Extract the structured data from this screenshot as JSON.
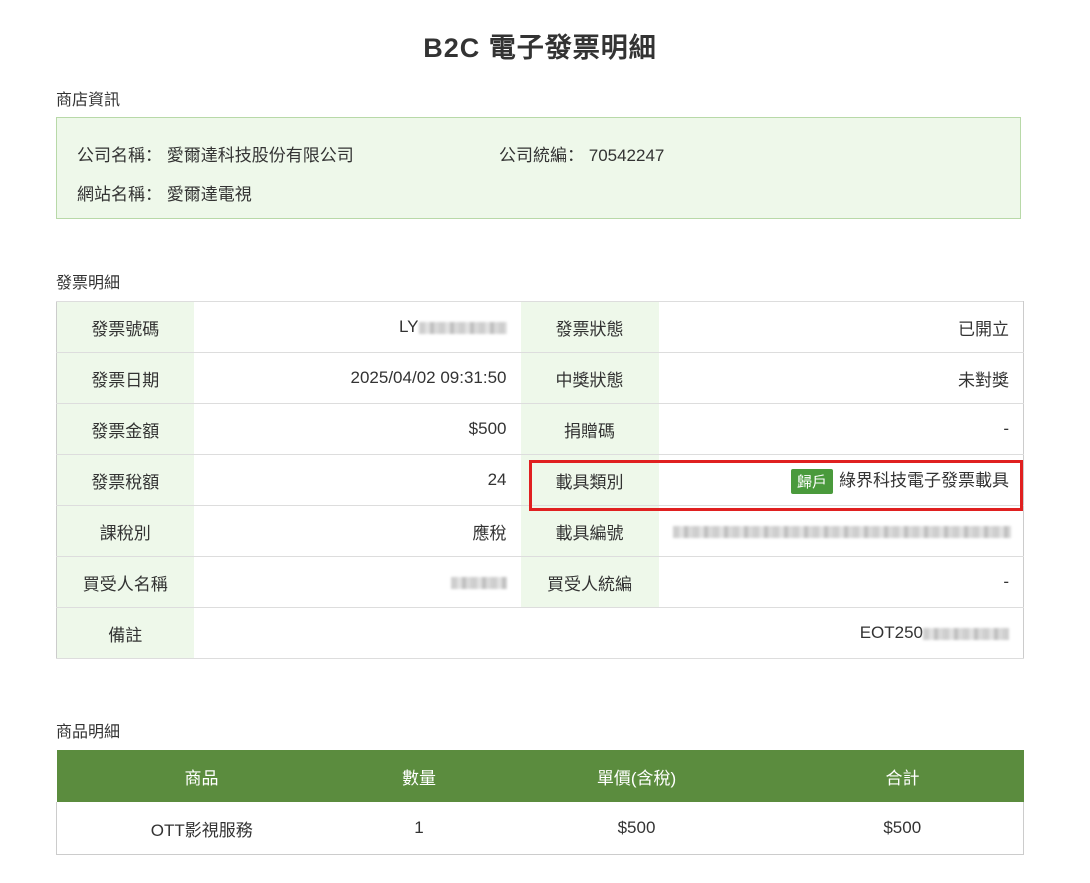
{
  "title": "B2C 電子發票明細",
  "store": {
    "section_label": "商店資訊",
    "company_name_label": "公司名稱：",
    "company_name": "愛爾達科技股份有限公司",
    "tax_id_label": "公司統編：",
    "tax_id": "70542247",
    "site_name_label": "網站名稱：",
    "site_name": "愛爾達電視"
  },
  "invoice": {
    "section_label": "發票明細",
    "number_label": "發票號碼",
    "number_prefix": "LY",
    "status_label": "發票狀態",
    "status": "已開立",
    "date_label": "發票日期",
    "date": "2025/04/02 09:31:50",
    "prize_label": "中獎狀態",
    "prize": "未對獎",
    "amount_label": "發票金額",
    "amount": "$500",
    "donation_label": "捐贈碼",
    "donation": "-",
    "tax_label": "發票稅額",
    "tax": "24",
    "carrier_type_label": "載具類別",
    "carrier_badge": "歸戶",
    "carrier_type": "綠界科技電子發票載具",
    "tax_type_label": "課稅別",
    "tax_type": "應稅",
    "carrier_no_label": "載具編號",
    "buyer_name_label": "買受人名稱",
    "buyer_tax_id_label": "買受人統編",
    "buyer_tax_id": "-",
    "remark_label": "備註",
    "remark_prefix": "EOT250"
  },
  "products": {
    "section_label": "商品明細",
    "columns": [
      "商品",
      "數量",
      "單價(含稅)",
      "合計"
    ],
    "rows": [
      [
        "OTT影視服務",
        "1",
        "$500",
        "$500"
      ]
    ]
  },
  "colors": {
    "accent_green": "#5b8c3e",
    "light_green_bg": "#eef8ea",
    "badge_green": "#4a9a3c",
    "highlight_red": "#e02020"
  }
}
